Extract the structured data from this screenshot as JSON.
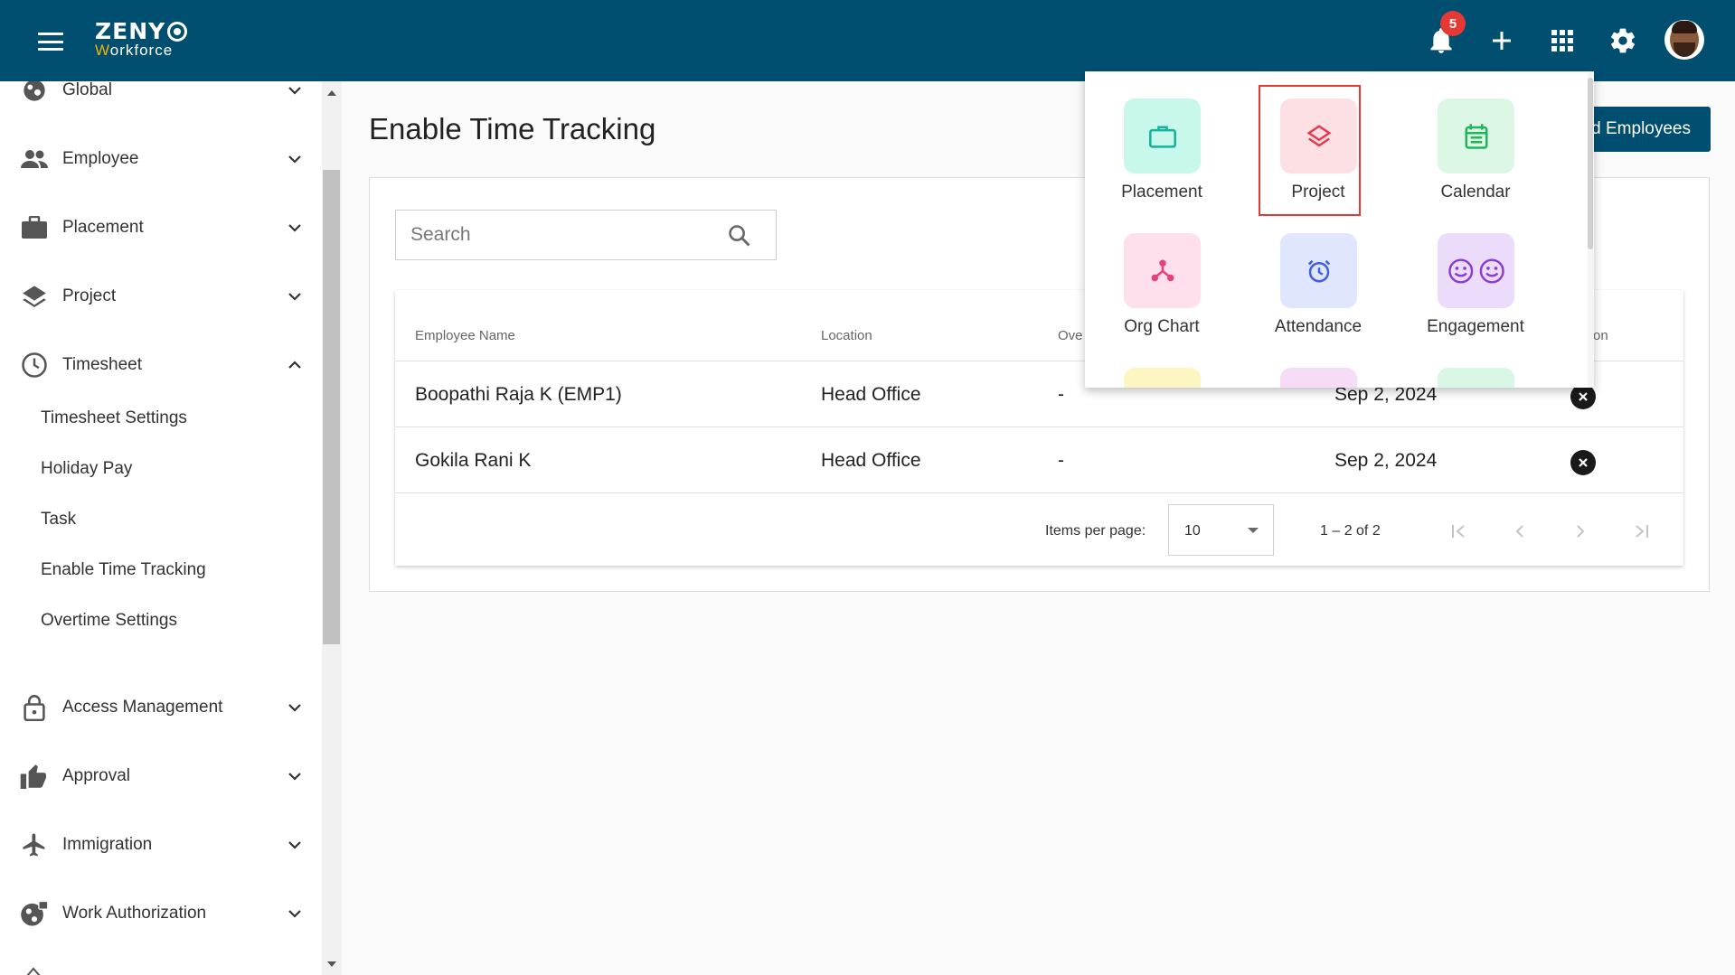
{
  "app": {
    "logo_top": "ZENY",
    "logo_bottom_w": "W",
    "logo_bottom_rest": "orkforce"
  },
  "topbar": {
    "notification_count": "5",
    "icons": [
      "menu-icon",
      "bell-icon",
      "plus-icon",
      "apps-grid-icon",
      "gear-icon",
      "avatar"
    ]
  },
  "sidebar": {
    "items": [
      {
        "label": "Global",
        "icon": "globe-icon",
        "expanded": false
      },
      {
        "label": "Employee",
        "icon": "people-icon",
        "expanded": false
      },
      {
        "label": "Placement",
        "icon": "briefcase-icon",
        "expanded": false
      },
      {
        "label": "Project",
        "icon": "layers-icon",
        "expanded": false
      },
      {
        "label": "Timesheet",
        "icon": "clock-icon",
        "expanded": true
      },
      {
        "label": "Access Management",
        "icon": "lock-icon",
        "expanded": false
      },
      {
        "label": "Approval",
        "icon": "thumbs-up-icon",
        "expanded": false
      },
      {
        "label": "Immigration",
        "icon": "airplane-icon",
        "expanded": false
      },
      {
        "label": "Work Authorization",
        "icon": "globe-lock-icon",
        "expanded": false
      }
    ],
    "timesheet_sub": [
      "Timesheet Settings",
      "Holiday Pay",
      "Task",
      "Enable Time Tracking",
      "Overtime Settings"
    ]
  },
  "main": {
    "title": "Enable Time Tracking",
    "add_button_label": "d Employees",
    "search_placeholder": "Search",
    "columns": [
      "Employee Name",
      "Location",
      "Ove",
      "on"
    ],
    "rows": [
      {
        "name": "Boopathi Raja K (EMP1)",
        "location": "Head Office",
        "overtime": "-",
        "date": "Sep 2, 2024"
      },
      {
        "name": "Gokila Rani K",
        "location": "Head Office",
        "overtime": "-",
        "date": "Sep 2, 2024"
      }
    ],
    "pagination": {
      "items_per_page_label": "Items per page:",
      "items_per_page_value": "10",
      "range": "1 – 2 of 2"
    }
  },
  "apps_menu": {
    "apps": [
      {
        "label": "Placement",
        "icon": "briefcase-outline-icon",
        "bg": "#c8f7ec",
        "fg": "#11b39a"
      },
      {
        "label": "Project",
        "icon": "layers-outline-icon",
        "bg": "#fde0e3",
        "fg": "#e53950",
        "selected": true
      },
      {
        "label": "Calendar",
        "icon": "calendar-icon",
        "bg": "#dcf7e6",
        "fg": "#22b45a"
      },
      {
        "label": "Org Chart",
        "icon": "org-chart-icon",
        "bg": "#fde0ec",
        "fg": "#e8407e"
      },
      {
        "label": "Attendance",
        "icon": "alarm-clock-icon",
        "bg": "#dfe6fd",
        "fg": "#3f5fe0"
      },
      {
        "label": "Engagement",
        "icon": "smiley-faces-icon",
        "bg": "#ecdcfb",
        "fg": "#8a3cd0"
      }
    ],
    "peek_colors": [
      "#fdf6c2",
      "#f7dcf7",
      "#d7f6e3"
    ]
  }
}
